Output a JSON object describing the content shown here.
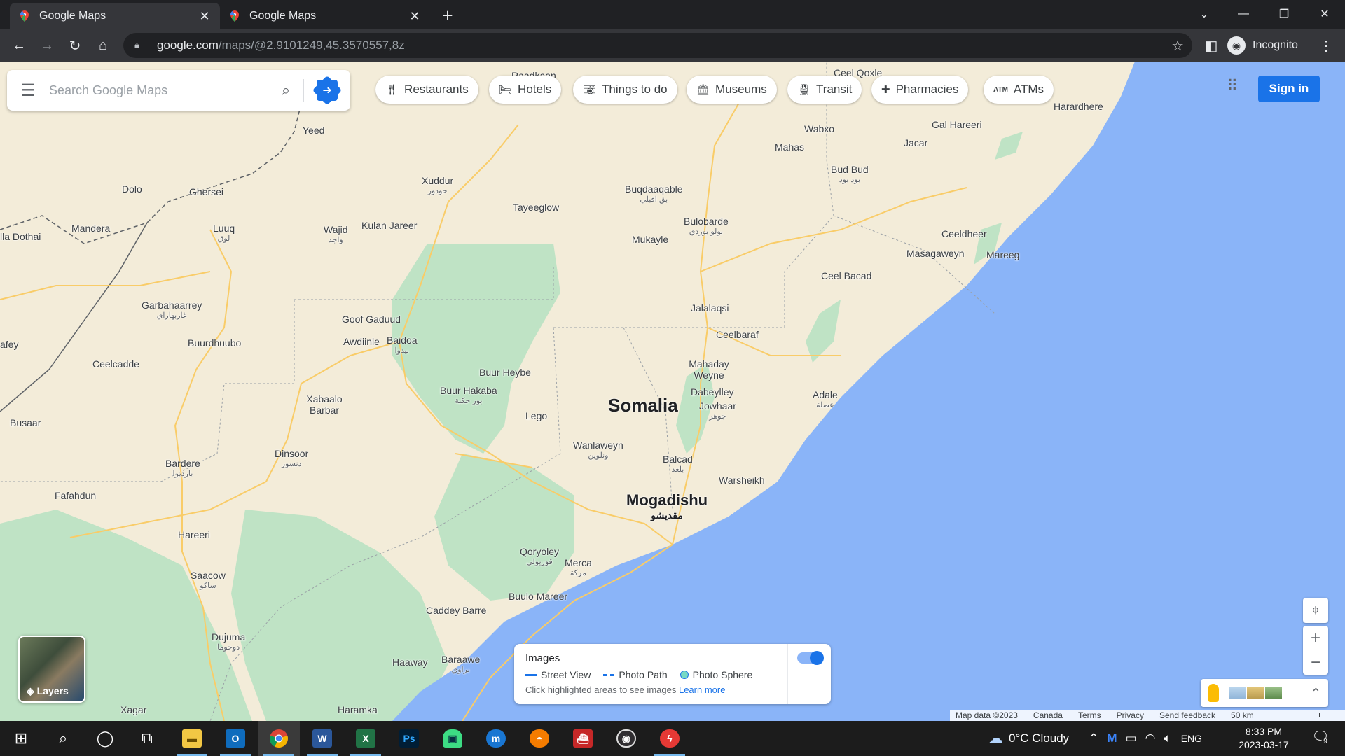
{
  "browser": {
    "tabs": [
      {
        "title": "Google Maps",
        "active": true
      },
      {
        "title": "Google Maps",
        "active": false
      }
    ],
    "url_host": "google.com",
    "url_path": "/maps/@2.9101249,45.3570557,8z",
    "profile_label": "Incognito"
  },
  "maps": {
    "search_placeholder": "Search Google Maps",
    "chips": [
      "Restaurants",
      "Hotels",
      "Things to do",
      "Museums",
      "Transit",
      "Pharmacies",
      "ATMs"
    ],
    "sign_in": "Sign in",
    "layers_label": "Layers",
    "images_panel": {
      "title": "Images",
      "street_view": "Street View",
      "photo_path": "Photo Path",
      "photo_sphere": "Photo Sphere",
      "hint": "Click highlighted areas to see images",
      "learn_more": "Learn more"
    },
    "footer": {
      "map_data": "Map data ©2023",
      "region": "Canada",
      "terms": "Terms",
      "privacy": "Privacy",
      "feedback": "Send feedback",
      "scale": "50 km"
    },
    "places": [
      {
        "name": "Ceel Qoxle"
      },
      {
        "name": "Raadkaan"
      },
      {
        "name": "Harardhere"
      },
      {
        "name": "Gal Hareeri"
      },
      {
        "name": "Wabxo"
      },
      {
        "name": "Mahas"
      },
      {
        "name": "Jacar"
      },
      {
        "name": "Bud Bud",
        "arabic": "بود بود"
      },
      {
        "name": "Yeed"
      },
      {
        "name": "Xuddur",
        "arabic": "حودور"
      },
      {
        "name": "Buqdaaqable",
        "arabic": "بق اقبلي"
      },
      {
        "name": "Tayeeglow"
      },
      {
        "name": "Dolo"
      },
      {
        "name": "Ghersei"
      },
      {
        "name": "Bulobarde",
        "arabic": "بولو بوردي"
      },
      {
        "name": "Luuq",
        "arabic": "لوق"
      },
      {
        "name": "Wajid",
        "arabic": "واجد"
      },
      {
        "name": "Kulan Jareer"
      },
      {
        "name": "Mukayle"
      },
      {
        "name": "Mandera"
      },
      {
        "name": "Ceeldheer"
      },
      {
        "name": "lla Dothai"
      },
      {
        "name": "Masagaweyn"
      },
      {
        "name": "Mareeg"
      },
      {
        "name": "Ceel Bacad"
      },
      {
        "name": "Garbahaarrey",
        "arabic": "غاربهاراي"
      },
      {
        "name": "Jalalaqsi"
      },
      {
        "name": "Goof Gaduud"
      },
      {
        "name": "Awdiinle"
      },
      {
        "name": "Baidoa",
        "arabic": "بيدوا"
      },
      {
        "name": "Ceelbaraf"
      },
      {
        "name": "afey"
      },
      {
        "name": "Buurdhuubo"
      },
      {
        "name": "Ceelcadde"
      },
      {
        "name": "Mahaday Weyne"
      },
      {
        "name": "Buur Heybe"
      },
      {
        "name": "Dabeylley"
      },
      {
        "name": "Buur Hakaba",
        "arabic": "بور حكبة"
      },
      {
        "name": "Adale",
        "arabic": "عضلة"
      },
      {
        "name": "Jowhaar",
        "arabic": "جوهر"
      },
      {
        "name": "Xabaalo Barbar"
      },
      {
        "name": "Somalia"
      },
      {
        "name": "Lego"
      },
      {
        "name": "Busaar"
      },
      {
        "name": "Wanlaweyn",
        "arabic": "ونلوين"
      },
      {
        "name": "Dinsoor",
        "arabic": "دنسور"
      },
      {
        "name": "Balcad",
        "arabic": "بلعد"
      },
      {
        "name": "Bardere",
        "arabic": "بارديرا"
      },
      {
        "name": "Warsheikh"
      },
      {
        "name": "Fafahdun"
      },
      {
        "name": "Mogadishu",
        "arabic": "مقديشو"
      },
      {
        "name": "Hareeri"
      },
      {
        "name": "Qoryoley",
        "arabic": "قوريولي"
      },
      {
        "name": "Merca",
        "arabic": "مركة"
      },
      {
        "name": "Saacow",
        "arabic": "ساكو"
      },
      {
        "name": "Buulo Mareer"
      },
      {
        "name": "Caddey Barre"
      },
      {
        "name": "Dujuma",
        "arabic": "دوجوما"
      },
      {
        "name": "Haaway"
      },
      {
        "name": "Baraawe",
        "arabic": "براوي"
      },
      {
        "name": "Xagar"
      },
      {
        "name": "Haramka"
      }
    ]
  },
  "taskbar": {
    "weather": "0°C  Cloudy",
    "lang": "ENG",
    "time": "8:33 PM",
    "date": "2023-03-17",
    "notif_count": "9",
    "apps": [
      "file-explorer",
      "outlook",
      "chrome",
      "word",
      "excel",
      "photoshop",
      "android-studio",
      "muse",
      "app-orange",
      "app-red-ship",
      "obs",
      "app-red-bolt"
    ]
  },
  "colors": {
    "land": "#f3ecd9",
    "park": "#bfe3c5",
    "water": "#8ab4f8",
    "accent": "#1a73e8",
    "road": "#f9cc68"
  }
}
